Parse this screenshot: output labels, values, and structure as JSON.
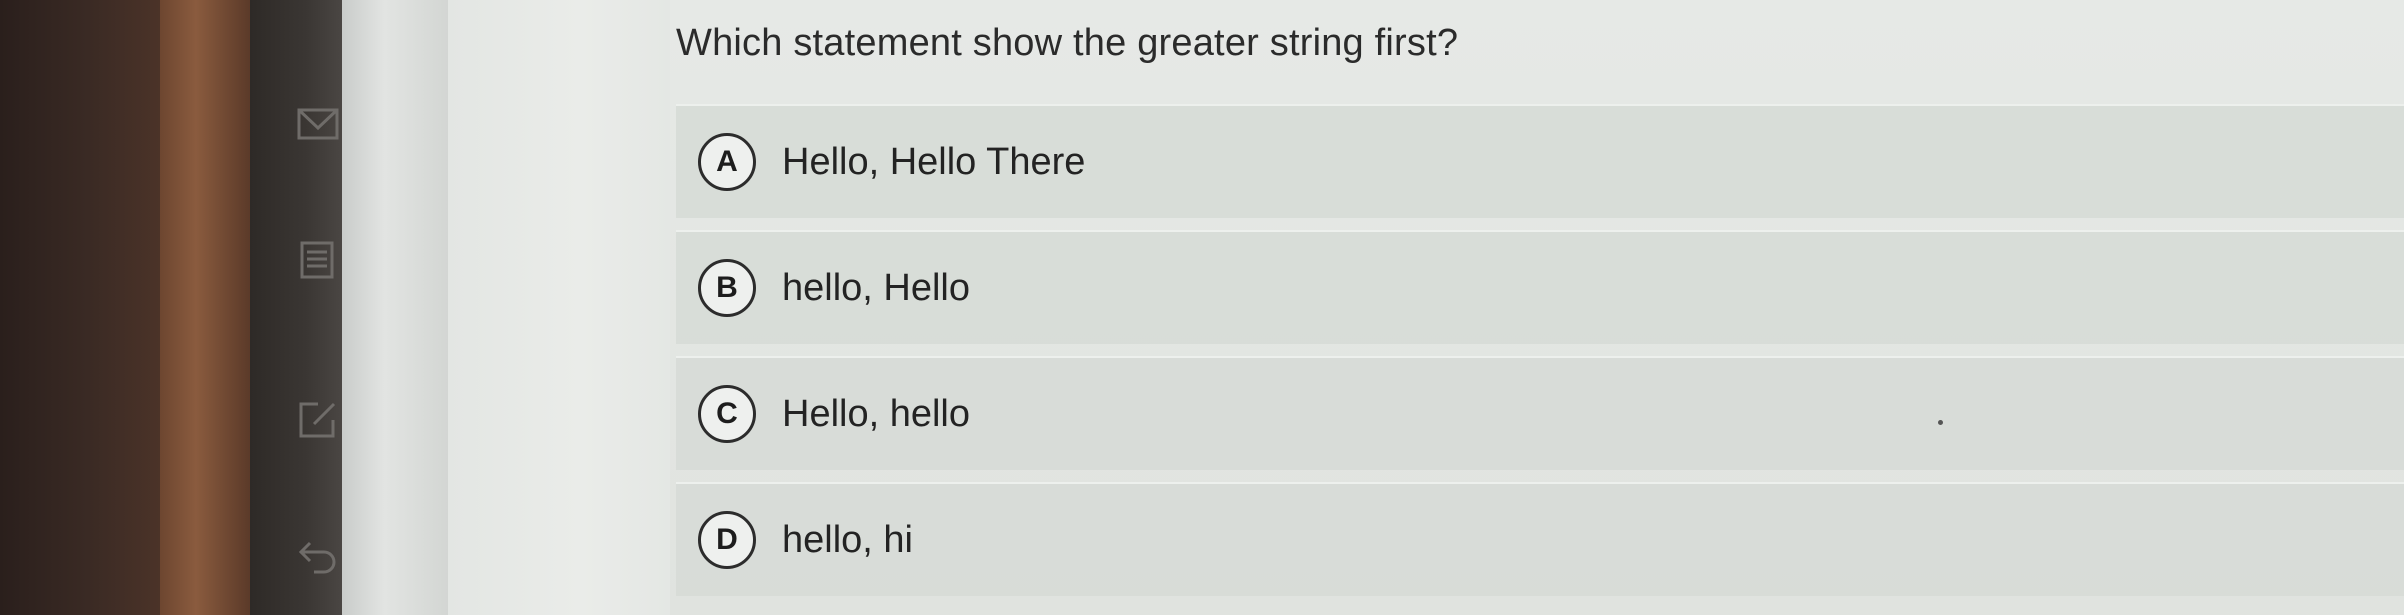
{
  "question": {
    "text": "Which statement show the greater string first?"
  },
  "options": [
    {
      "letter": "A",
      "text": "Hello, Hello There"
    },
    {
      "letter": "B",
      "text": "hello, Hello"
    },
    {
      "letter": "C",
      "text": "Hello, hello"
    },
    {
      "letter": "D",
      "text": "hello, hi"
    }
  ],
  "sidebar": {
    "icons": [
      "mail-icon",
      "document-icon",
      "edit-icon",
      "back-arrow-icon"
    ]
  },
  "colors": {
    "text": "#232323",
    "option_background": "#d6dad6",
    "page_background": "#e3e6e2"
  }
}
